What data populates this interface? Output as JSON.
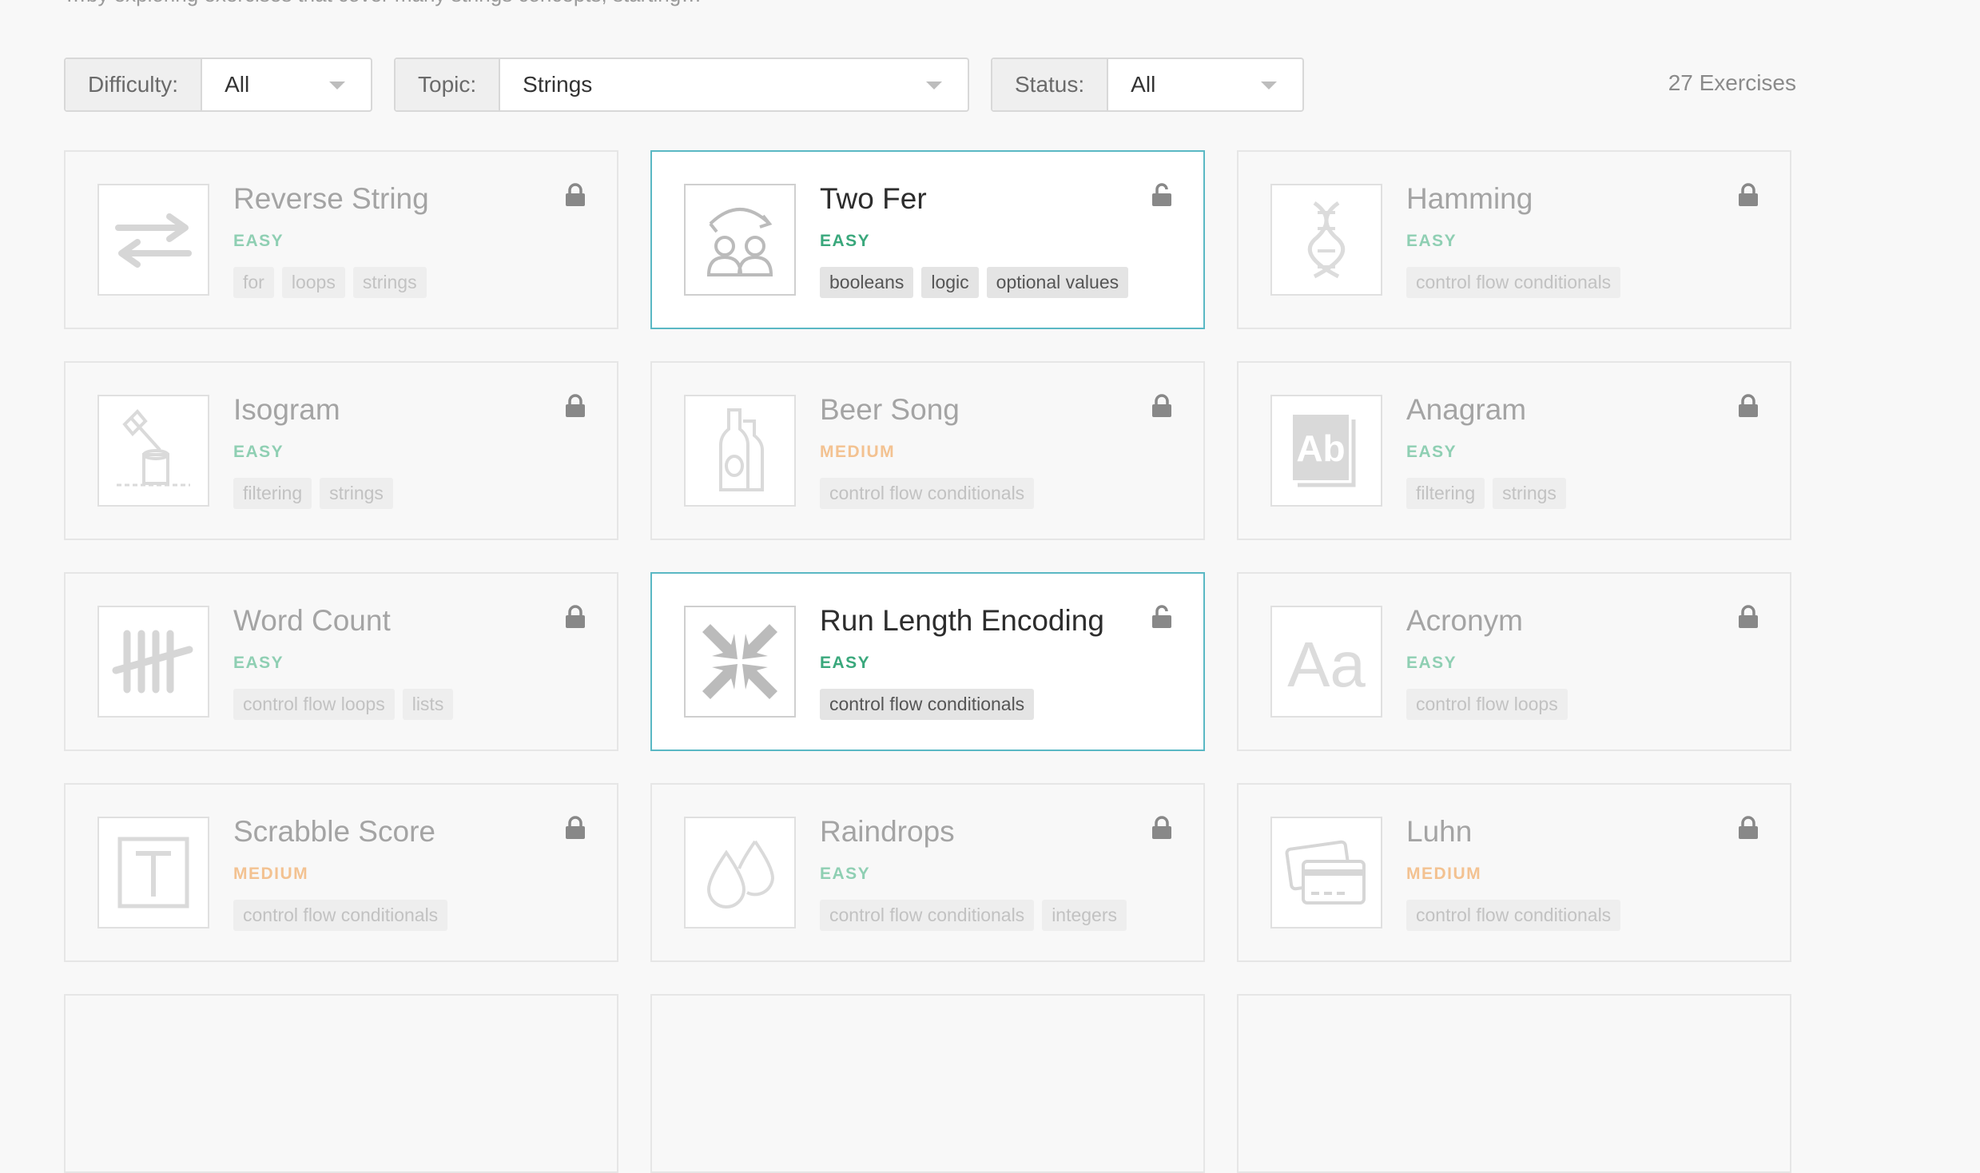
{
  "header_text": "…by exploring exercises that cover many strings concepts, starting…",
  "filters": {
    "difficulty": {
      "label": "Difficulty:",
      "value": "All"
    },
    "topic": {
      "label": "Topic:",
      "value": "Strings"
    },
    "status": {
      "label": "Status:",
      "value": "All"
    }
  },
  "exercise_count": "27 Exercises",
  "colors": {
    "accent": "#5ab8c4",
    "easy": "#3aa87c",
    "medium": "#f3c291"
  },
  "exercises": [
    {
      "title": "Reverse String",
      "difficulty": "EASY",
      "tags": [
        "for",
        "loops",
        "strings"
      ],
      "icon": "arrows-swap-icon",
      "unlocked": false
    },
    {
      "title": "Two Fer",
      "difficulty": "EASY",
      "tags": [
        "booleans",
        "logic",
        "optional values"
      ],
      "icon": "two-people-icon",
      "unlocked": true
    },
    {
      "title": "Hamming",
      "difficulty": "EASY",
      "tags": [
        "control flow conditionals"
      ],
      "icon": "dna-icon",
      "unlocked": false
    },
    {
      "title": "Isogram",
      "difficulty": "EASY",
      "tags": [
        "filtering",
        "strings"
      ],
      "icon": "axe-stump-icon",
      "unlocked": false
    },
    {
      "title": "Beer Song",
      "difficulty": "MEDIUM",
      "tags": [
        "control flow conditionals"
      ],
      "icon": "bottles-icon",
      "unlocked": false
    },
    {
      "title": "Anagram",
      "difficulty": "EASY",
      "tags": [
        "filtering",
        "strings"
      ],
      "icon": "ab-book-icon",
      "unlocked": false
    },
    {
      "title": "Word Count",
      "difficulty": "EASY",
      "tags": [
        "control flow loops",
        "lists"
      ],
      "icon": "tally-marks-icon",
      "unlocked": false
    },
    {
      "title": "Run Length Encoding",
      "difficulty": "EASY",
      "tags": [
        "control flow conditionals"
      ],
      "icon": "compress-arrows-icon",
      "unlocked": true
    },
    {
      "title": "Acronym",
      "difficulty": "EASY",
      "tags": [
        "control flow loops"
      ],
      "icon": "aa-letters-icon",
      "unlocked": false
    },
    {
      "title": "Scrabble Score",
      "difficulty": "MEDIUM",
      "tags": [
        "control flow conditionals"
      ],
      "icon": "letter-tile-icon",
      "unlocked": false
    },
    {
      "title": "Raindrops",
      "difficulty": "EASY",
      "tags": [
        "control flow conditionals",
        "integers"
      ],
      "icon": "raindrops-icon",
      "unlocked": false
    },
    {
      "title": "Luhn",
      "difficulty": "MEDIUM",
      "tags": [
        "control flow conditionals"
      ],
      "icon": "credit-cards-icon",
      "unlocked": false
    }
  ]
}
